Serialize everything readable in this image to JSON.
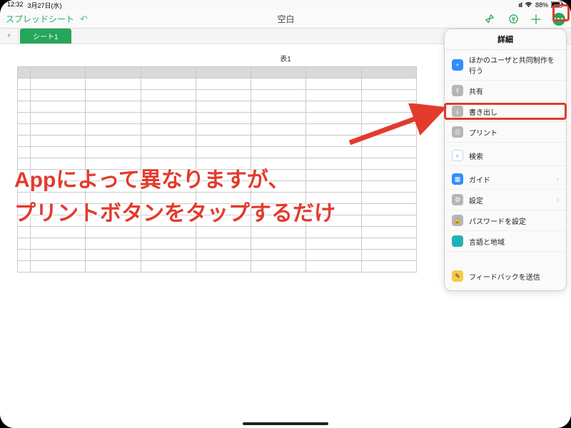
{
  "status": {
    "time": "12:32",
    "date": "3月27日(水)",
    "battery": "88%"
  },
  "toolbar": {
    "back_label": "スプレッドシート",
    "doc_title": "空白"
  },
  "sheet_tabs": {
    "add_label": "+",
    "tabs": [
      {
        "label": "シート1"
      }
    ]
  },
  "table": {
    "title": "表1"
  },
  "popover": {
    "title": "詳細",
    "items": [
      {
        "icon": "person-add-icon",
        "color": "mi-blue",
        "label": "ほかのユーザと共同制作を行う"
      },
      {
        "icon": "share-icon",
        "color": "mi-gray",
        "label": "共有"
      },
      {
        "icon": "export-icon",
        "color": "mi-gray",
        "label": "書き出し"
      },
      {
        "icon": "printer-icon",
        "color": "mi-gray",
        "label": "プリント"
      },
      {
        "icon": "search-icon",
        "color": "mi-search",
        "label": "検索"
      },
      {
        "icon": "guide-icon",
        "color": "mi-blue",
        "label": "ガイド",
        "chevron": true
      },
      {
        "icon": "settings-icon",
        "color": "mi-gray",
        "label": "設定",
        "chevron": true
      },
      {
        "icon": "lock-icon",
        "color": "mi-gray",
        "label": "パスワードを設定"
      },
      {
        "icon": "globe-icon",
        "color": "mi-green",
        "label": "言語と地域"
      }
    ],
    "feedback": {
      "icon": "feedback-icon",
      "color": "mi-yellow",
      "label": "フィードバックを送信"
    }
  },
  "annotation": {
    "line1": "Appによって異なりますが、",
    "line2": "プリントボタンをタップするだけ"
  },
  "colors": {
    "highlight": "#e23b2e",
    "accent": "#26a65b"
  }
}
